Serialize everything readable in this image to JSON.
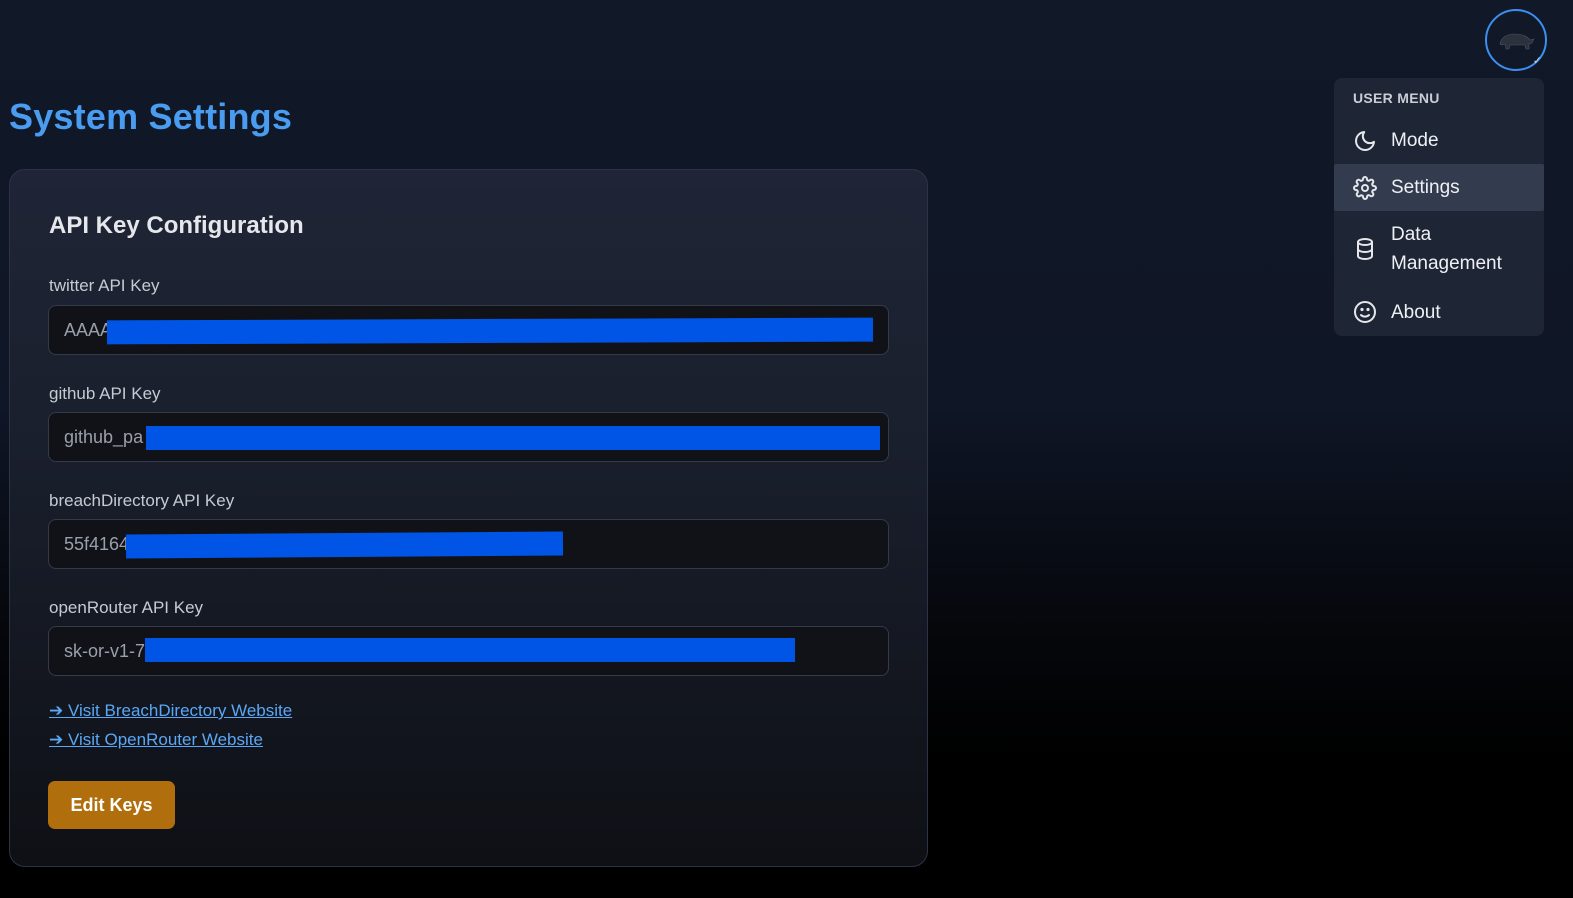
{
  "page": {
    "title": "System Settings"
  },
  "card": {
    "title": "API Key Configuration",
    "fields": [
      {
        "label": "twitter API Key",
        "value": "AAAA"
      },
      {
        "label": "github API Key",
        "value": "github_pa"
      },
      {
        "label": "breachDirectory API Key",
        "value": "55f4164"
      },
      {
        "label": "openRouter API Key",
        "value": "sk-or-v1-7"
      }
    ],
    "links": [
      "➔ Visit BreachDirectory Website",
      "➔ Visit OpenRouter Website"
    ],
    "edit_button": "Edit Keys"
  },
  "user_menu": {
    "header": "USER MENU",
    "items": [
      {
        "label": "Mode",
        "icon": "moon-icon"
      },
      {
        "label": "Settings",
        "icon": "gear-icon",
        "active": true
      },
      {
        "label": "Data Management",
        "icon": "database-icon"
      },
      {
        "label": "About",
        "icon": "smile-icon"
      }
    ]
  },
  "colors": {
    "accent": "#4a9cf0",
    "button": "#b06e0c",
    "redaction": "#0055e6"
  }
}
